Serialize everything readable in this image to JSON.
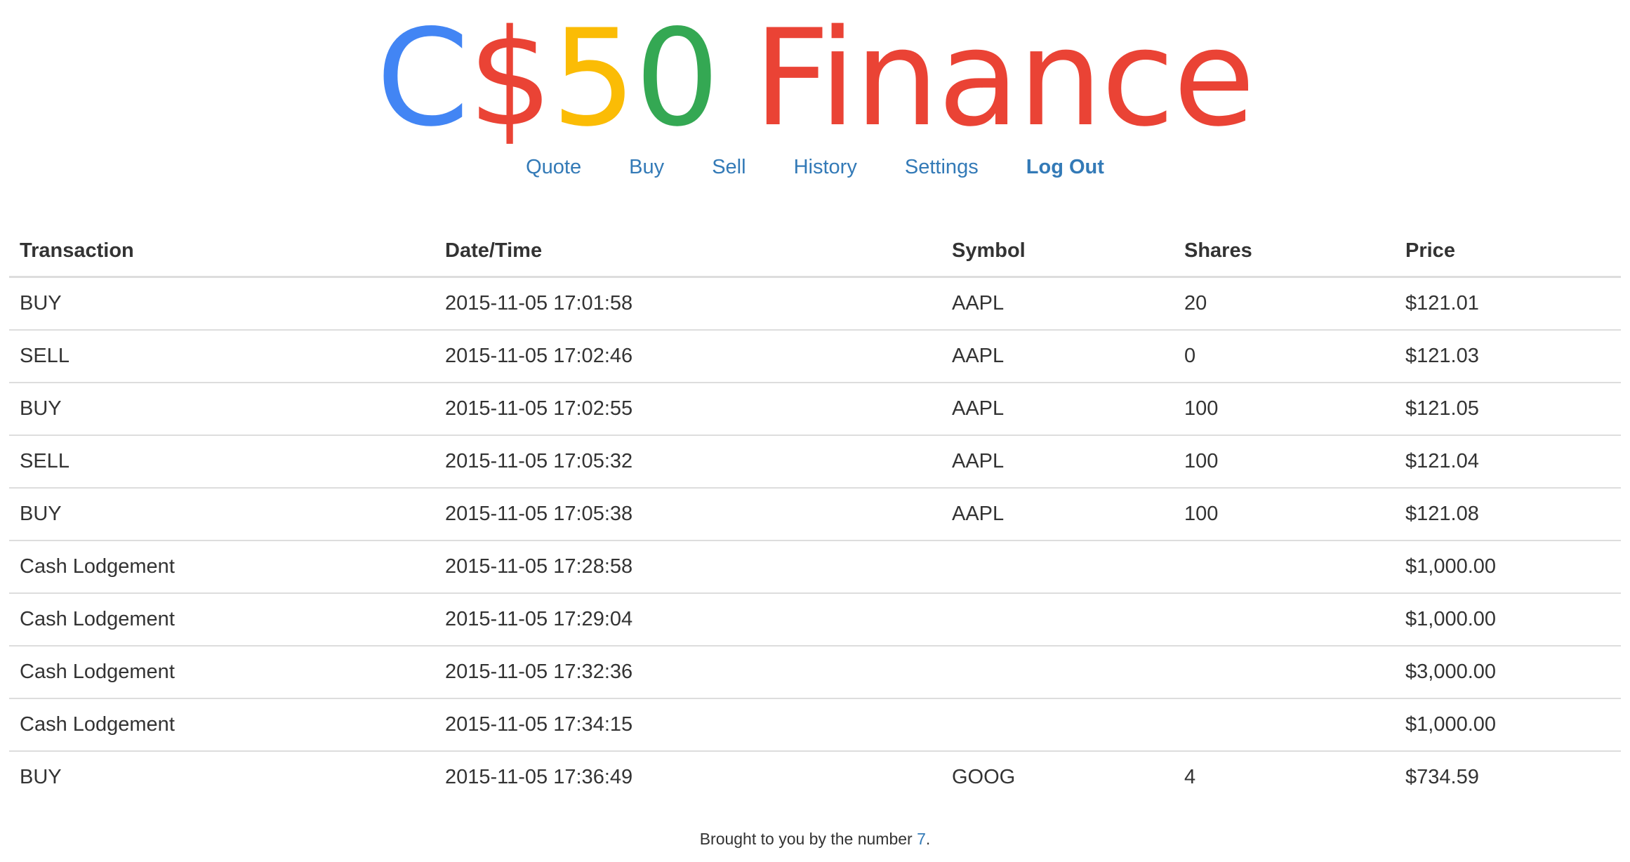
{
  "brand": {
    "c": "C",
    "dollar": "$",
    "five": "5",
    "zero": "0",
    "finance": "Finance",
    "colors": {
      "c": "#4285f4",
      "dollar": "#ea4335",
      "five": "#fbbc05",
      "zero": "#34a853",
      "finance": "#ea4335"
    }
  },
  "nav": {
    "quote": "Quote",
    "buy": "Buy",
    "sell": "Sell",
    "history": "History",
    "settings": "Settings",
    "logout": "Log Out",
    "link_color": "#337ab7"
  },
  "table": {
    "headers": {
      "transaction": "Transaction",
      "datetime": "Date/Time",
      "symbol": "Symbol",
      "shares": "Shares",
      "price": "Price"
    },
    "rows": [
      {
        "transaction": "BUY",
        "datetime": "2015-11-05 17:01:58",
        "symbol": "AAPL",
        "shares": "20",
        "price": "$121.01"
      },
      {
        "transaction": "SELL",
        "datetime": "2015-11-05 17:02:46",
        "symbol": "AAPL",
        "shares": "0",
        "price": "$121.03"
      },
      {
        "transaction": "BUY",
        "datetime": "2015-11-05 17:02:55",
        "symbol": "AAPL",
        "shares": "100",
        "price": "$121.05"
      },
      {
        "transaction": "SELL",
        "datetime": "2015-11-05 17:05:32",
        "symbol": "AAPL",
        "shares": "100",
        "price": "$121.04"
      },
      {
        "transaction": "BUY",
        "datetime": "2015-11-05 17:05:38",
        "symbol": "AAPL",
        "shares": "100",
        "price": "$121.08"
      },
      {
        "transaction": "Cash Lodgement",
        "datetime": "2015-11-05 17:28:58",
        "symbol": "",
        "shares": "",
        "price": "$1,000.00"
      },
      {
        "transaction": "Cash Lodgement",
        "datetime": "2015-11-05 17:29:04",
        "symbol": "",
        "shares": "",
        "price": "$1,000.00"
      },
      {
        "transaction": "Cash Lodgement",
        "datetime": "2015-11-05 17:32:36",
        "symbol": "",
        "shares": "",
        "price": "$3,000.00"
      },
      {
        "transaction": "Cash Lodgement",
        "datetime": "2015-11-05 17:34:15",
        "symbol": "",
        "shares": "",
        "price": "$1,000.00"
      },
      {
        "transaction": "BUY",
        "datetime": "2015-11-05 17:36:49",
        "symbol": "GOOG",
        "shares": "4",
        "price": "$734.59"
      }
    ]
  },
  "footer": {
    "prefix": "Brought to you by the number ",
    "number": "7",
    "suffix": "."
  }
}
